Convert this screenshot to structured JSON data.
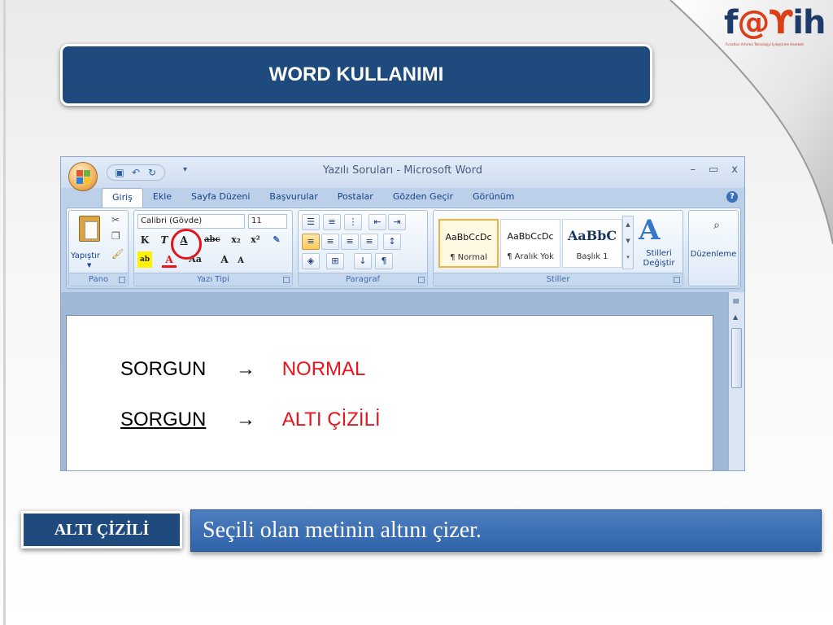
{
  "slide": {
    "title": "WORD KULLANIMI",
    "logo": {
      "text_1": "f",
      "text_2": "@",
      "text_3": "ih",
      "subtitle": "Fırsatları Artırma Teknolojiyi İyileştirme Hareketi"
    },
    "callout": {
      "tag": "ALTI ÇİZİLİ",
      "description": "Seçili olan metinin altını çizer."
    }
  },
  "word": {
    "window_title": "Yazılı Soruları - Microsoft Word",
    "window_controls": [
      "–",
      "▭",
      "x"
    ],
    "tabs": [
      "Giriş",
      "Ekle",
      "Sayfa Düzeni",
      "Başvurular",
      "Postalar",
      "Gözden Geçir",
      "Görünüm"
    ],
    "ribbon": {
      "clipboard": {
        "label": "Pano",
        "paste": "Yapıştır"
      },
      "font": {
        "label": "Yazı Tipi",
        "font_name": "Calibri (Gövde)",
        "font_size": "11",
        "bold": "K",
        "italic": "T",
        "underline": "A",
        "strikethrough": "abc",
        "subscript": "x₂",
        "superscript": "x²",
        "grow": "A",
        "shrink": "A",
        "change_case": "Aa"
      },
      "paragraph": {
        "label": "Paragraf"
      },
      "styles": {
        "label": "Stiller",
        "items": [
          {
            "sample": "AaBbCcDc",
            "name": "¶ Normal"
          },
          {
            "sample": "AaBbCcDc",
            "name": "¶ Aralık Yok"
          },
          {
            "sample": "AaBbC",
            "name": "Başlık 1"
          }
        ],
        "change_styles": "Stilleri Değiştir"
      },
      "editing": {
        "label": "Düzenleme"
      }
    },
    "document": {
      "lines": [
        {
          "left": "SORGUN",
          "arrow": "→",
          "right": "NORMAL"
        },
        {
          "left": "SORGUN",
          "arrow": "→",
          "right": "ALTI ÇİZİLİ"
        }
      ]
    }
  },
  "colors": {
    "title_bg": "#1f4a7e",
    "red": "#e8141a",
    "desc_bg": "#3a6db3"
  }
}
